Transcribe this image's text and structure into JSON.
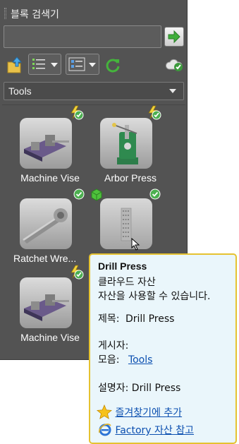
{
  "panel": {
    "title": "블록 검색기",
    "search": {
      "value": "",
      "placeholder": ""
    },
    "category": "Tools",
    "colors": {
      "panel_bg": "#535353",
      "accent_green": "#4caf50",
      "badge_yellow": "#f2d23a"
    },
    "icons": {
      "go": "arrow-right-icon",
      "up_folder": "folder-up-icon",
      "view_list": "list-view-icon",
      "view_details": "details-view-icon",
      "refresh": "refresh-icon",
      "cloud": "cloud-check-icon"
    },
    "tiles": [
      {
        "name": "Machine Vise",
        "badge": "lightning-check"
      },
      {
        "name": "Arbor Press",
        "badge": "lightning-check"
      },
      {
        "name": "Ratchet Wre...",
        "badge": "check"
      },
      {
        "name": "",
        "badge": "cube-check"
      },
      {
        "name": "Machine Vise",
        "badge": "lightning-check"
      }
    ]
  },
  "tooltip": {
    "title": "Drill Press",
    "line1": "클라우드 자산",
    "line2": "자산을 사용할 수 있습니다.",
    "title_label": "제목:",
    "title_value": "Drill Press",
    "publisher_label": "게시자:",
    "collection_label": "모음:",
    "collection_value": "Tools",
    "author": "설명자: Drill Press",
    "favorite_link": "즐겨찾기에 추가",
    "factory_link": "Factory 자산 참고"
  }
}
